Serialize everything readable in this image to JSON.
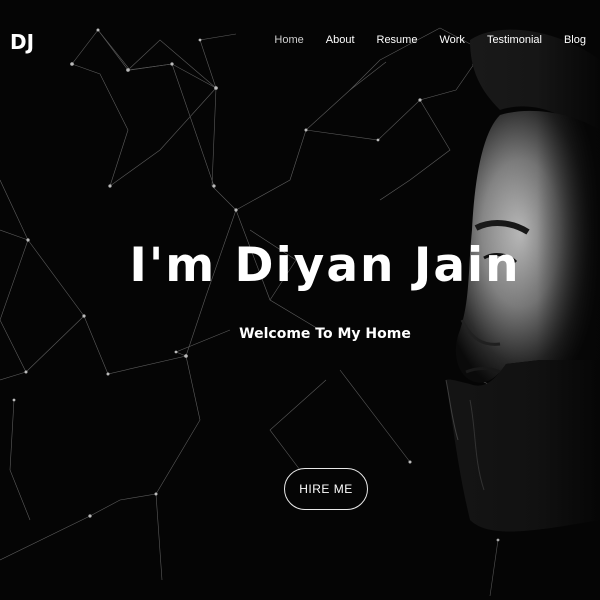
{
  "header": {
    "logo": "DJ",
    "nav": [
      {
        "label": "Home",
        "active": true
      },
      {
        "label": "About",
        "active": false
      },
      {
        "label": "Resume",
        "active": false
      },
      {
        "label": "Work",
        "active": false
      },
      {
        "label": "Testimonial",
        "active": false
      },
      {
        "label": "Blog",
        "active": false
      }
    ]
  },
  "hero": {
    "title": "I'm Diyan Jain",
    "subtitle": "Welcome To My Home",
    "cta_label": "HIRE ME"
  },
  "colors": {
    "background": "#050505",
    "text": "#ffffff",
    "network_lines": "#8a8a8a"
  }
}
